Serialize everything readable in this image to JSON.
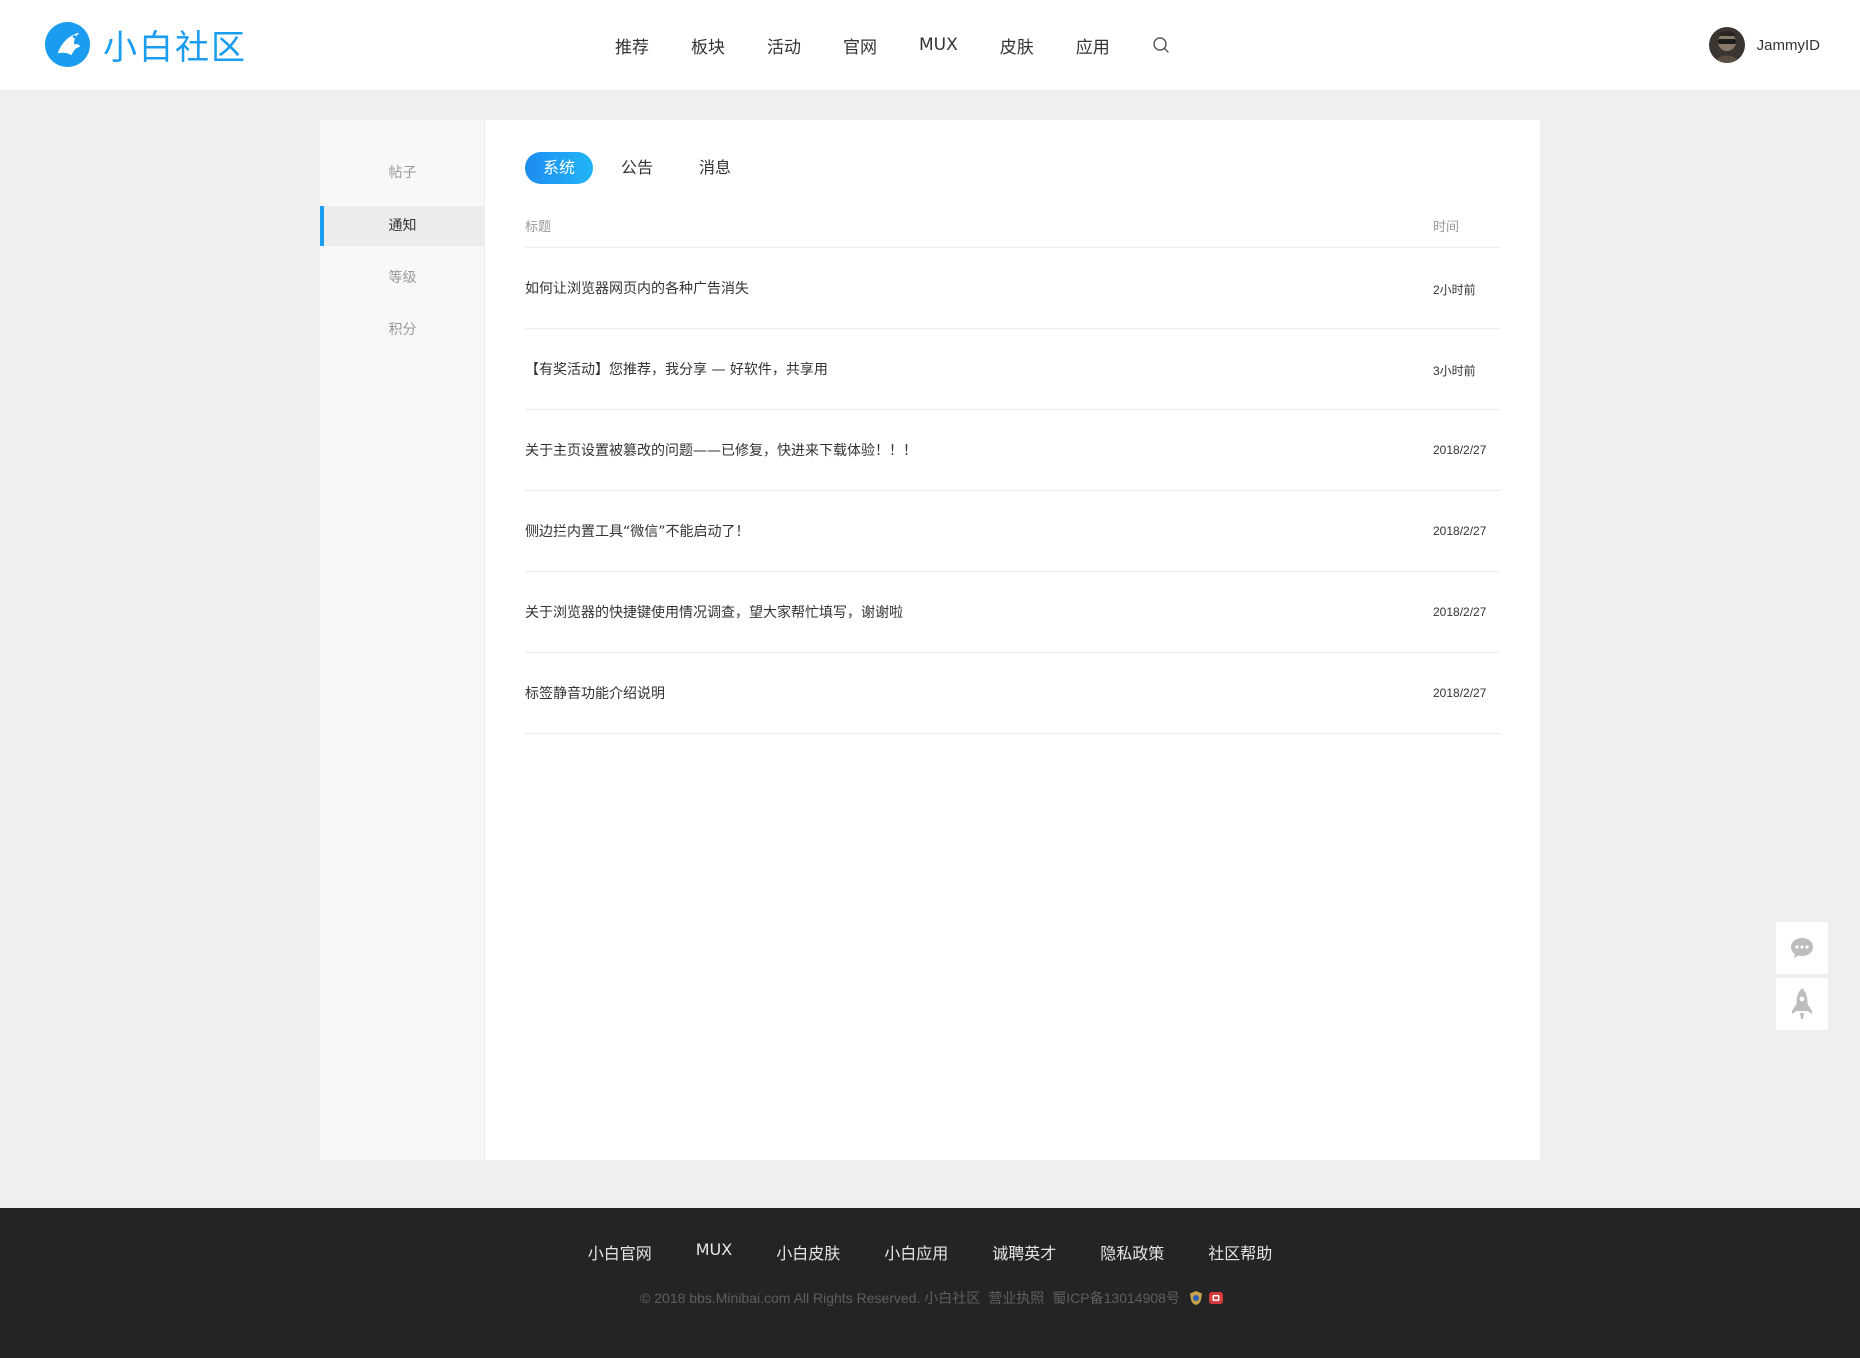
{
  "header": {
    "brand": "小白社区",
    "nav": [
      "推荐",
      "板块",
      "活动",
      "官网",
      "MUX",
      "皮肤",
      "应用"
    ],
    "user": {
      "name": "JammyID"
    }
  },
  "sidebar": {
    "items": [
      {
        "label": "帖子"
      },
      {
        "label": "通知"
      },
      {
        "label": "等级"
      },
      {
        "label": "积分"
      }
    ],
    "active": "通知"
  },
  "tabs": {
    "items": [
      "系统",
      "公告",
      "消息"
    ],
    "active": "系统"
  },
  "table": {
    "columns": {
      "title": "标题",
      "time": "时间"
    },
    "rows": [
      {
        "title": "如何让浏览器网页内的各种广告消失",
        "time": "2小时前"
      },
      {
        "title": "【有奖活动】您推荐，我分享 — 好软件，共享用",
        "time": "3小时前"
      },
      {
        "title": "关于主页设置被篡改的问题——已修复，快进来下载体验！！！",
        "time": "2018/2/27"
      },
      {
        "title": "侧边拦内置工具“微信”不能启动了！",
        "time": "2018/2/27"
      },
      {
        "title": "关于浏览器的快捷键使用情况调查，望大家帮忙填写，谢谢啦",
        "time": "2018/2/27"
      },
      {
        "title": "标签静音功能介绍说明",
        "time": "2018/2/27"
      }
    ]
  },
  "footer": {
    "links": [
      "小白官网",
      "MUX",
      "小白皮肤",
      "小白应用",
      "诚聘英才",
      "隐私政策",
      "社区帮助"
    ],
    "copyright": "© 2018 bbs.Minibai.com All Rights Reserved. 小白社区",
    "license": "营业执照",
    "icp": "蜀ICP备13014908号"
  },
  "colors": {
    "accent": "#1a9cf0",
    "page_bg": "#efefef",
    "footer_bg": "#242424"
  },
  "icons": [
    "logo-bird-icon",
    "search-icon",
    "chat-icon",
    "rocket-icon",
    "police-badge-icon",
    "license-badge-icon"
  ]
}
